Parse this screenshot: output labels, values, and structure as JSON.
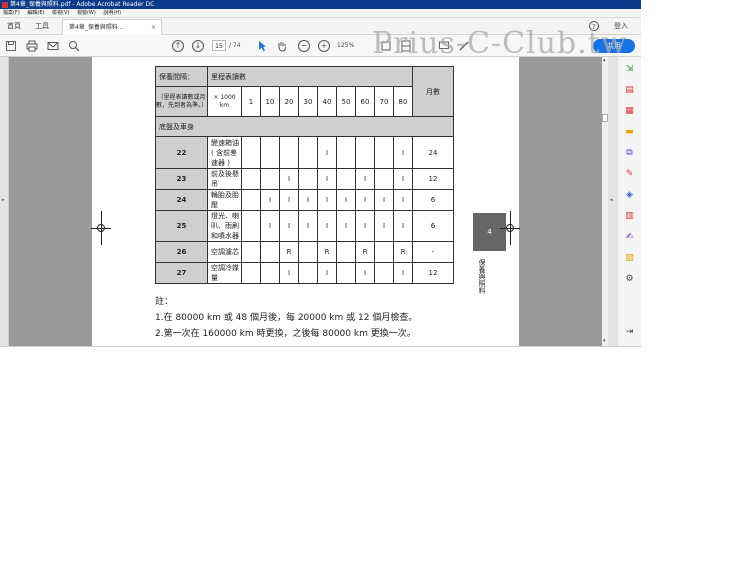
{
  "window": {
    "title": "第4章_保養與照料.pdf - Adobe Acrobat Reader DC"
  },
  "menu": [
    "檔案(F)",
    "編輯(E)",
    "檢視(V)",
    "視窗(W)",
    "說明(H)"
  ],
  "tabs": {
    "home": "首頁",
    "tools": "工具",
    "document": "第4章_保養與照料...",
    "close": "×"
  },
  "header": {
    "help": "?",
    "login": "登入"
  },
  "toolbar": {
    "page_current": "15",
    "page_total": "/ 74",
    "zoom": "125%",
    "share": "共用"
  },
  "watermark": "Prius-C-Club.tw",
  "table": {
    "header": {
      "interval": "保養間隔：",
      "odometer": "里程表讀數",
      "months": "月數"
    },
    "subheader": {
      "desc": "（里程表讀數或月數，先到者為準。）",
      "unit": "× 1000 km"
    },
    "km_columns": [
      "1",
      "10",
      "20",
      "30",
      "40",
      "50",
      "60",
      "70",
      "80"
    ],
    "section": "底盤及車身",
    "rows": [
      {
        "num": "22",
        "item": "變速箱油 ( 含前差速器 )",
        "cells": [
          "",
          "",
          "",
          "",
          "I",
          "",
          "",
          "",
          "I"
        ],
        "months": "24"
      },
      {
        "num": "23",
        "item": "前及後懸吊",
        "cells": [
          "",
          "",
          "I",
          "",
          "I",
          "",
          "I",
          "",
          "I"
        ],
        "months": "12"
      },
      {
        "num": "24",
        "item": "輪胎及胎壓",
        "cells": [
          "",
          "I",
          "I",
          "I",
          "I",
          "I",
          "I",
          "I",
          "I"
        ],
        "months": "6"
      },
      {
        "num": "25",
        "item": "燈光、喇叭、雨刷和噴水器",
        "cells": [
          "",
          "I",
          "I",
          "I",
          "I",
          "I",
          "I",
          "I",
          "I"
        ],
        "months": "6"
      },
      {
        "num": "26",
        "item": "空調濾芯",
        "cells": [
          "",
          "",
          "R",
          "",
          "R",
          "",
          "R",
          "",
          "R"
        ],
        "months": "-"
      },
      {
        "num": "27",
        "item": "空調冷媒量",
        "cells": [
          "",
          "",
          "I",
          "",
          "I",
          "",
          "I",
          "",
          "I"
        ],
        "months": "12"
      }
    ]
  },
  "side_tab": {
    "number": "4",
    "label": "保養與照料"
  },
  "notes": {
    "title": "註：",
    "items": [
      "1.在 80000 km 或 48 個月後，每 20000 km 或 12 個月檢查。",
      "2.第一次在 160000 km 時更換，之後每 80000 km 更換一次。"
    ]
  }
}
